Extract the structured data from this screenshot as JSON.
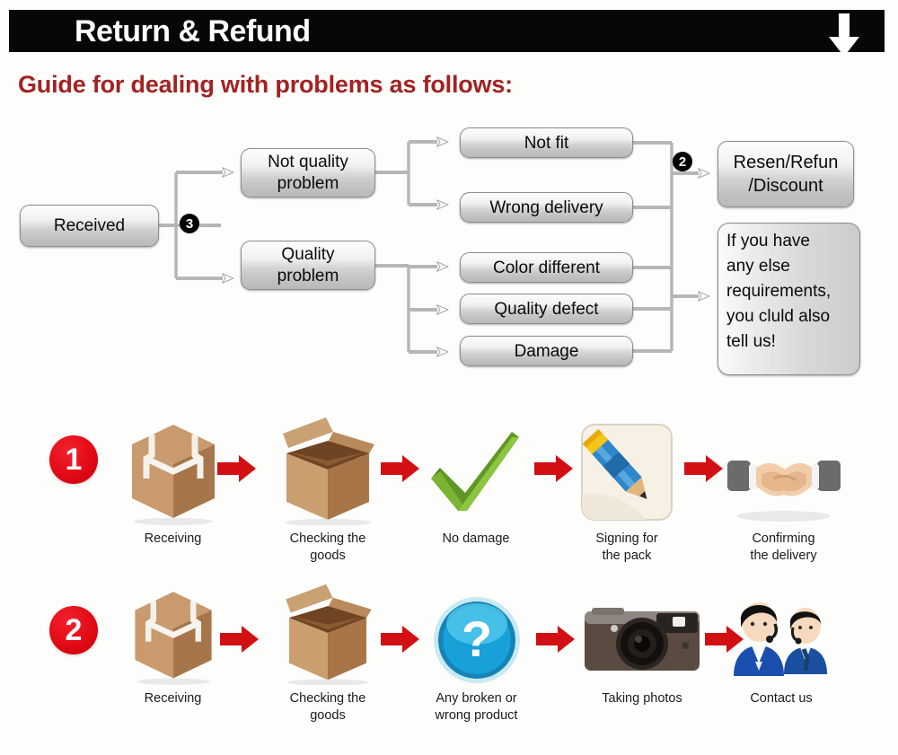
{
  "header": {
    "title": "Return & Refund",
    "arrow_icon": "down-arrow-icon",
    "bar_color": "#070707"
  },
  "guide": {
    "heading": "Guide for dealing with problems as follows:",
    "heading_color": "#a32222"
  },
  "flowchart": {
    "start": {
      "label": "Received"
    },
    "badges": {
      "three": "❶",
      "three_text": "3",
      "two_text": "2"
    },
    "categories": [
      {
        "label": "Not quality\nproblem"
      },
      {
        "label": "Quality\nproblem"
      }
    ],
    "problems": [
      {
        "label": "Not fit"
      },
      {
        "label": "Wrong delivery"
      },
      {
        "label": "Color different"
      },
      {
        "label": "Quality defect"
      },
      {
        "label": "Damage"
      }
    ],
    "outcomes": [
      {
        "label": "Resen/Refun\n/Discount"
      },
      {
        "label": "If you have\nany else\nrequirements,\nyou cluld also\ntell us!"
      }
    ]
  },
  "steps": {
    "row1": {
      "number": "1",
      "items": [
        {
          "label": "Receiving",
          "icon": "sealed-box-icon"
        },
        {
          "label": "Checking the\ngoods",
          "icon": "open-box-icon"
        },
        {
          "label": "No damage",
          "icon": "green-check-icon"
        },
        {
          "label": "Signing for\nthe pack",
          "icon": "pencil-sign-icon"
        },
        {
          "label": "Confirming\nthe delivery",
          "icon": "handshake-icon"
        }
      ]
    },
    "row2": {
      "number": "2",
      "items": [
        {
          "label": "Receiving",
          "icon": "sealed-box-icon"
        },
        {
          "label": "Checking the\ngoods",
          "icon": "open-box-icon"
        },
        {
          "label": "Any broken or\nwrong product",
          "icon": "question-mark-icon"
        },
        {
          "label": "Taking photos",
          "icon": "camera-icon"
        },
        {
          "label": "Contact us",
          "icon": "support-people-icon"
        }
      ]
    },
    "arrow_color": "#d21014",
    "number_color": "#e20a16"
  }
}
